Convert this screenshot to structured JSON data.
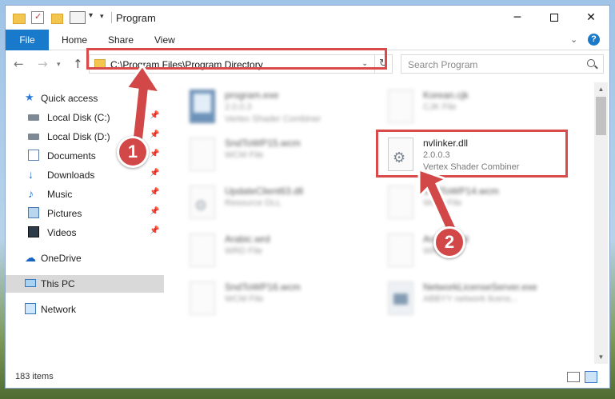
{
  "window": {
    "title": "Program",
    "controls": {
      "minimize": "─",
      "close": "✕"
    }
  },
  "ribbon": {
    "file_tab": "File",
    "tabs": [
      "Home",
      "Share",
      "View"
    ],
    "help": "?"
  },
  "address_bar": {
    "path": "C:\\Program Files\\Program Directory",
    "search_placeholder": "Search Program"
  },
  "nav_pane": {
    "items": [
      {
        "label": "Quick access",
        "icon": "star-icon",
        "pinned": false
      },
      {
        "label": "Local Disk (C:)",
        "icon": "drive-icon",
        "pinned": true
      },
      {
        "label": "Local Disk (D:)",
        "icon": "drive-icon",
        "pinned": true
      },
      {
        "label": "Documents",
        "icon": "documents-icon",
        "pinned": true
      },
      {
        "label": "Downloads",
        "icon": "downloads-icon",
        "pinned": true
      },
      {
        "label": "Music",
        "icon": "music-icon",
        "pinned": true
      },
      {
        "label": "Pictures",
        "icon": "pictures-icon",
        "pinned": true
      },
      {
        "label": "Videos",
        "icon": "videos-icon",
        "pinned": true
      },
      {
        "label": "OneDrive",
        "icon": "onedrive-icon",
        "pinned": false
      },
      {
        "label": "This PC",
        "icon": "this-pc-icon",
        "pinned": false,
        "selected": true
      },
      {
        "label": "Network",
        "icon": "network-icon",
        "pinned": false
      }
    ]
  },
  "files": [
    {
      "name": "program.exe",
      "line2": "2.0.0.3",
      "line3": "Vertex Shader Combiner",
      "icon": "exe-icon",
      "blurred": true
    },
    {
      "name": "Korean.cjk",
      "line2": "CJK File",
      "line3": "",
      "icon": "file-icon",
      "blurred": true
    },
    {
      "name": "SndToWP15.wcm",
      "line2": "WCM File",
      "line3": "",
      "icon": "file-icon",
      "blurred": true
    },
    {
      "name": "nvlinker.dll",
      "line2": "2.0.0.3",
      "line3": "Vertex Shader Combiner",
      "icon": "dll-gear-icon",
      "blurred": false
    },
    {
      "name": "UpdateClient63.dll",
      "line2": "Resource DLL",
      "line3": "",
      "icon": "dll-gear-icon",
      "blurred": true
    },
    {
      "name": "SndToWP14.wcm",
      "line2": "WCM File",
      "line3": "",
      "icon": "file-icon",
      "blurred": true
    },
    {
      "name": "Arabic.wrd",
      "line2": "WRD File",
      "line3": "",
      "icon": "file-icon",
      "blurred": true
    },
    {
      "name": "Arabic.wrd",
      "line2": "WRD File",
      "line3": "",
      "icon": "file-icon",
      "blurred": true
    },
    {
      "name": "SndToWP16.wcm",
      "line2": "WCM File",
      "line3": "",
      "icon": "file-icon",
      "blurred": true
    },
    {
      "name": "NetworkLicenseServer.exe",
      "line2": "ABBYY network licens...",
      "line3": "",
      "icon": "app-icon",
      "blurred": true
    }
  ],
  "status": {
    "item_count": "183 items"
  },
  "callouts": {
    "step1": "1",
    "step2": "2"
  },
  "colors": {
    "accent": "#1979ca",
    "highlight": "#d94a4a"
  }
}
